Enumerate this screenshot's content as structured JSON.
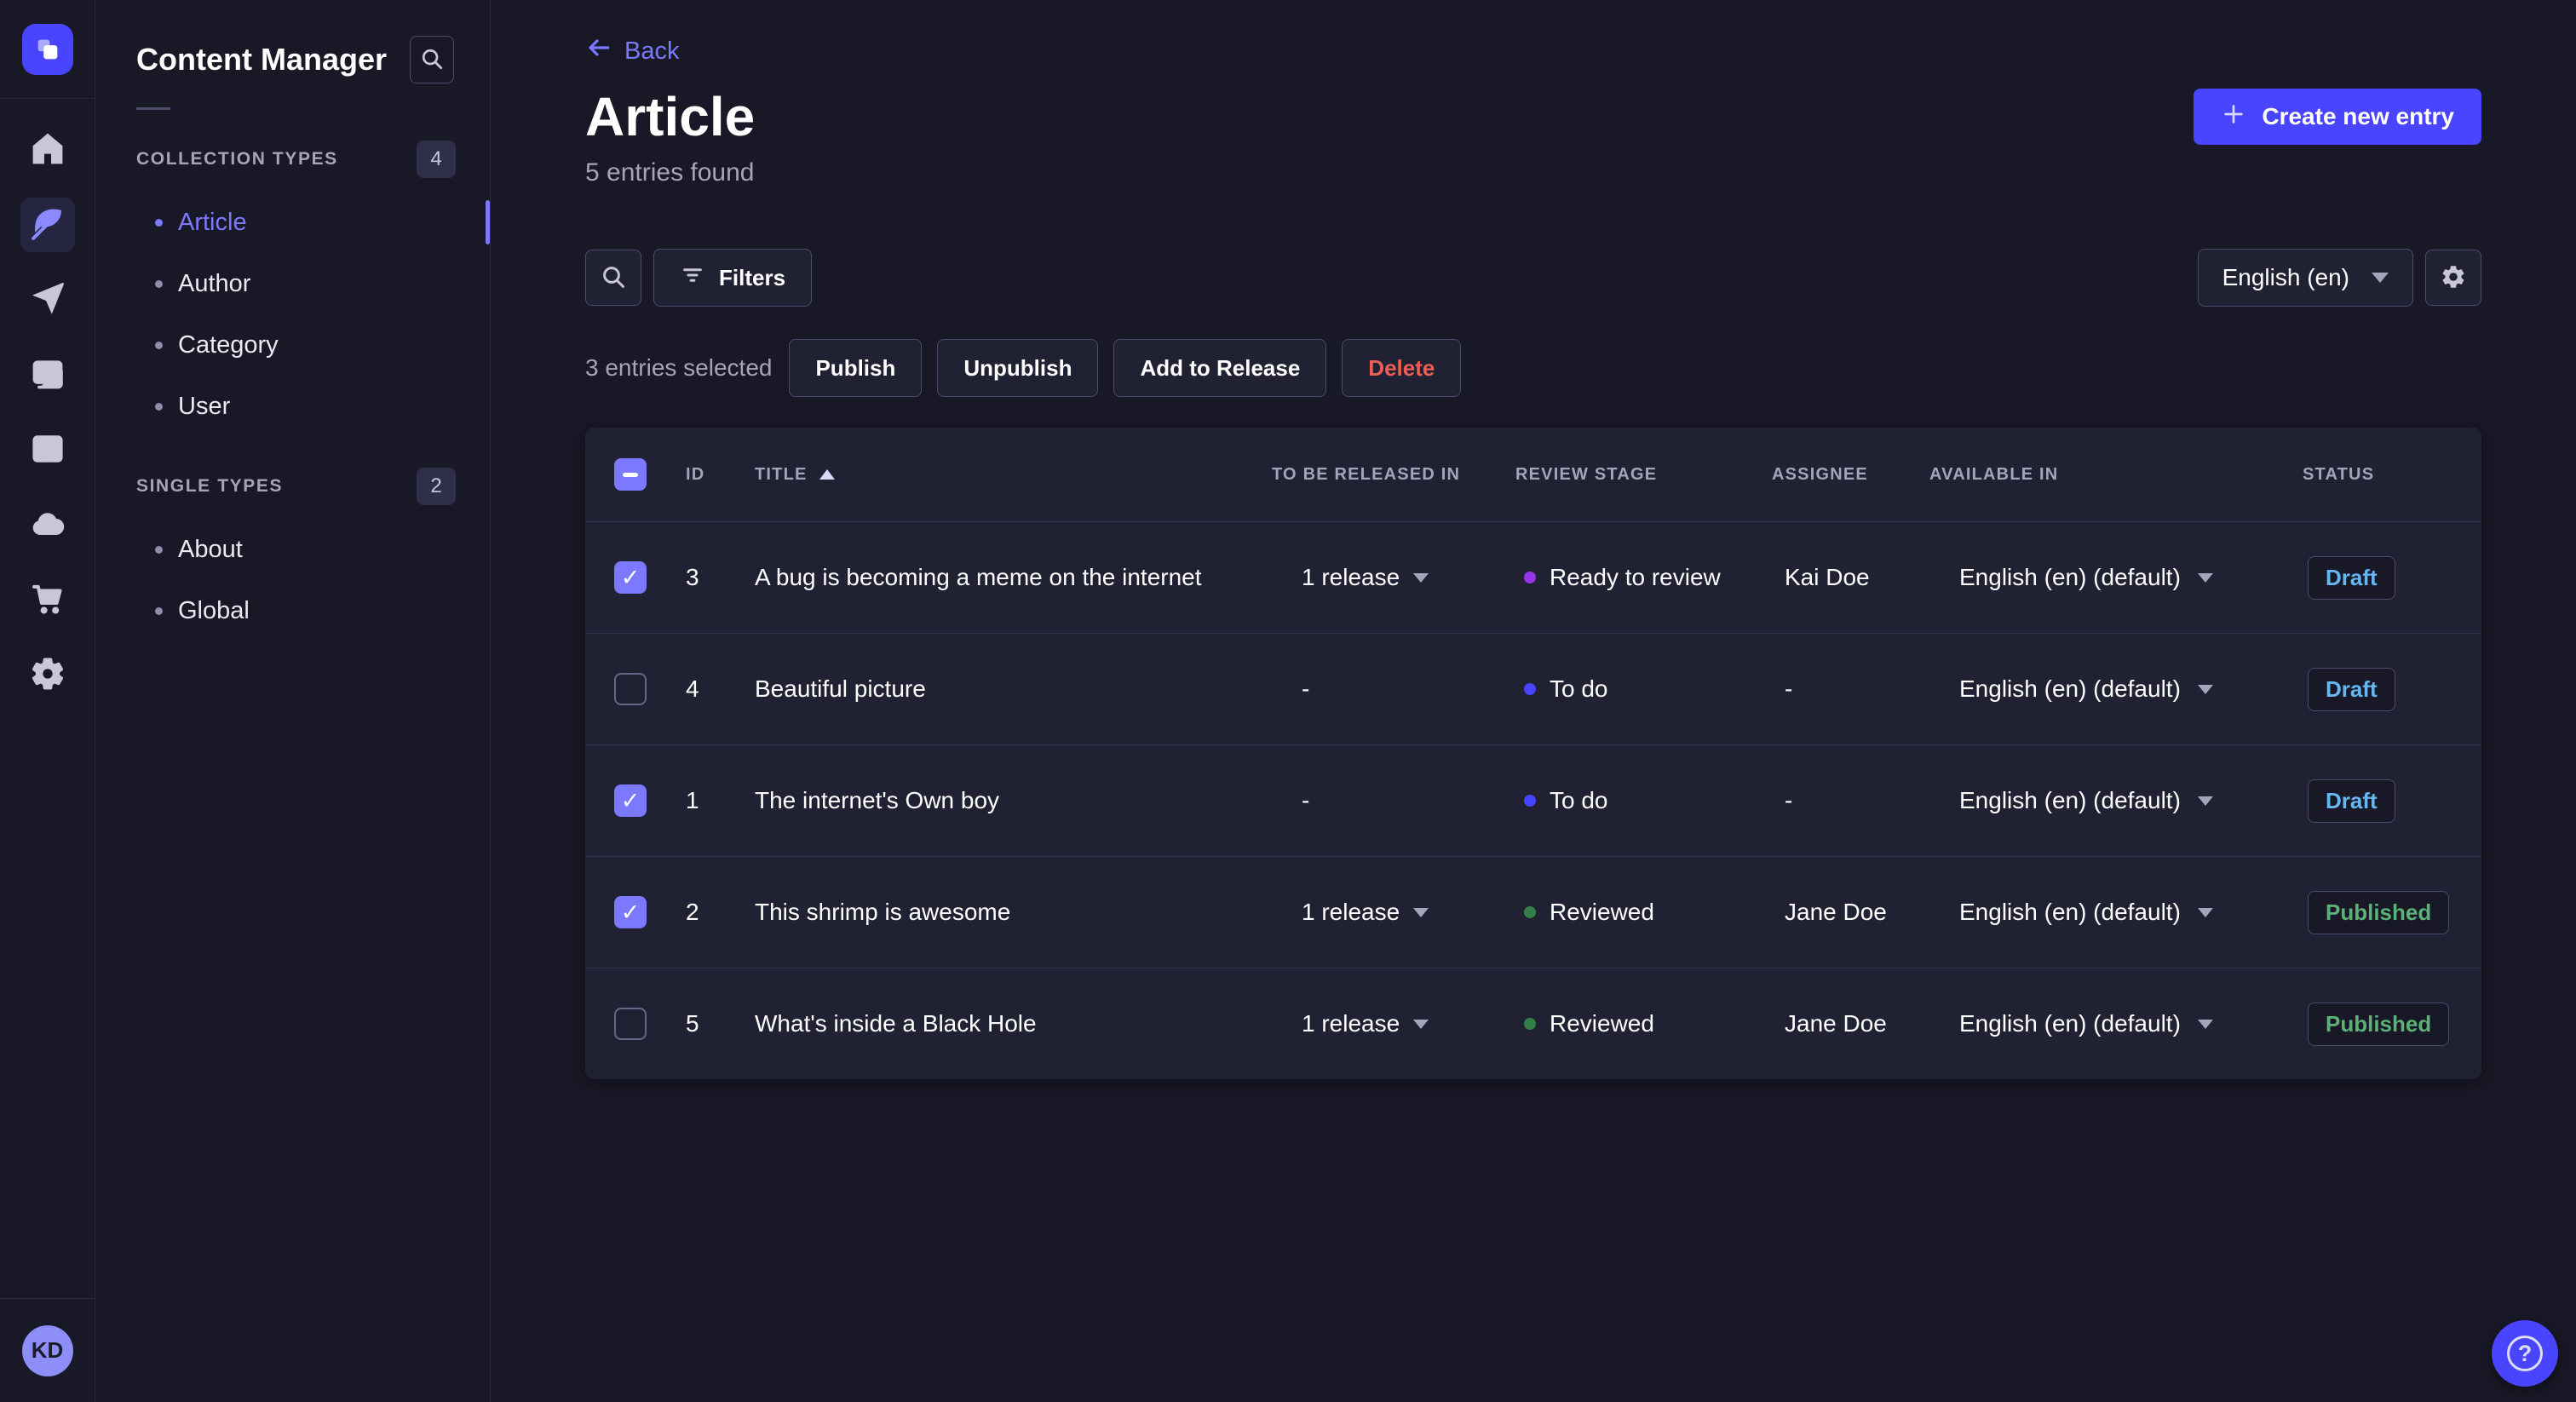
{
  "rail": {
    "avatar_initials": "KD",
    "items": [
      {
        "icon": "home-icon"
      },
      {
        "icon": "feather-icon",
        "active": true
      },
      {
        "icon": "send-icon"
      },
      {
        "icon": "media-library-icon"
      },
      {
        "icon": "layout-icon"
      },
      {
        "icon": "cloud-icon"
      },
      {
        "icon": "cart-icon"
      },
      {
        "icon": "gear-icon"
      }
    ]
  },
  "sidebar": {
    "title": "Content Manager",
    "collection_types": {
      "label": "COLLECTION TYPES",
      "count": "4",
      "items": [
        {
          "label": "Article",
          "active": true
        },
        {
          "label": "Author"
        },
        {
          "label": "Category"
        },
        {
          "label": "User"
        }
      ]
    },
    "single_types": {
      "label": "SINGLE TYPES",
      "count": "2",
      "items": [
        {
          "label": "About"
        },
        {
          "label": "Global"
        }
      ]
    }
  },
  "header": {
    "back_label": "Back",
    "title": "Article",
    "subtitle": "5 entries found",
    "create_button_label": "Create new entry"
  },
  "toolbar": {
    "filters_label": "Filters",
    "locale_value": "English (en)"
  },
  "bulkbar": {
    "selected_text": "3 entries selected",
    "publish_label": "Publish",
    "unpublish_label": "Unpublish",
    "add_to_release_label": "Add to Release",
    "delete_label": "Delete"
  },
  "table": {
    "headers": {
      "id": "ID",
      "title": "TITLE",
      "release": "TO BE RELEASED IN",
      "review": "REVIEW STAGE",
      "assignee": "ASSIGNEE",
      "available": "AVAILABLE IN",
      "status": "STATUS"
    },
    "sort": {
      "column": "TITLE",
      "direction": "asc"
    },
    "rows": [
      {
        "check": "checked",
        "id": "3",
        "title": "A bug is becoming a meme on the internet",
        "release": "1 release",
        "has_release": true,
        "stage": "Ready to review",
        "stage_kind": "ready",
        "assignee": "Kai Doe",
        "available": "English (en) (default)",
        "status": "Draft",
        "status_kind": "draft"
      },
      {
        "check": "unchecked",
        "id": "4",
        "title": "Beautiful picture",
        "release": "-",
        "has_release": false,
        "stage": "To do",
        "stage_kind": "todo",
        "assignee": "-",
        "available": "English (en) (default)",
        "status": "Draft",
        "status_kind": "draft"
      },
      {
        "check": "checked",
        "id": "1",
        "title": "The internet's Own boy",
        "release": "-",
        "has_release": false,
        "stage": "To do",
        "stage_kind": "todo",
        "assignee": "-",
        "available": "English (en) (default)",
        "status": "Draft",
        "status_kind": "draft"
      },
      {
        "check": "checked",
        "id": "2",
        "title": "This shrimp is awesome",
        "release": "1 release",
        "has_release": true,
        "stage": "Reviewed",
        "stage_kind": "reviewed",
        "assignee": "Jane Doe",
        "available": "English (en) (default)",
        "status": "Published",
        "status_kind": "published"
      },
      {
        "check": "unchecked",
        "id": "5",
        "title": "What's inside a Black Hole",
        "release": "1 release",
        "has_release": true,
        "stage": "Reviewed",
        "stage_kind": "reviewed",
        "assignee": "Jane Doe",
        "available": "English (en) (default)",
        "status": "Published",
        "status_kind": "published"
      }
    ]
  },
  "colors": {
    "primary": "#4945ff",
    "primary_light": "#7b79ff",
    "danger": "#ee5e52",
    "success": "#5cb176",
    "draft_text": "#66b7f1",
    "stage_ready_to_review": "#9736e8",
    "stage_to_do": "#4945ff",
    "stage_reviewed": "#328048",
    "page_bg": "#181826",
    "card_bg": "#212134"
  }
}
